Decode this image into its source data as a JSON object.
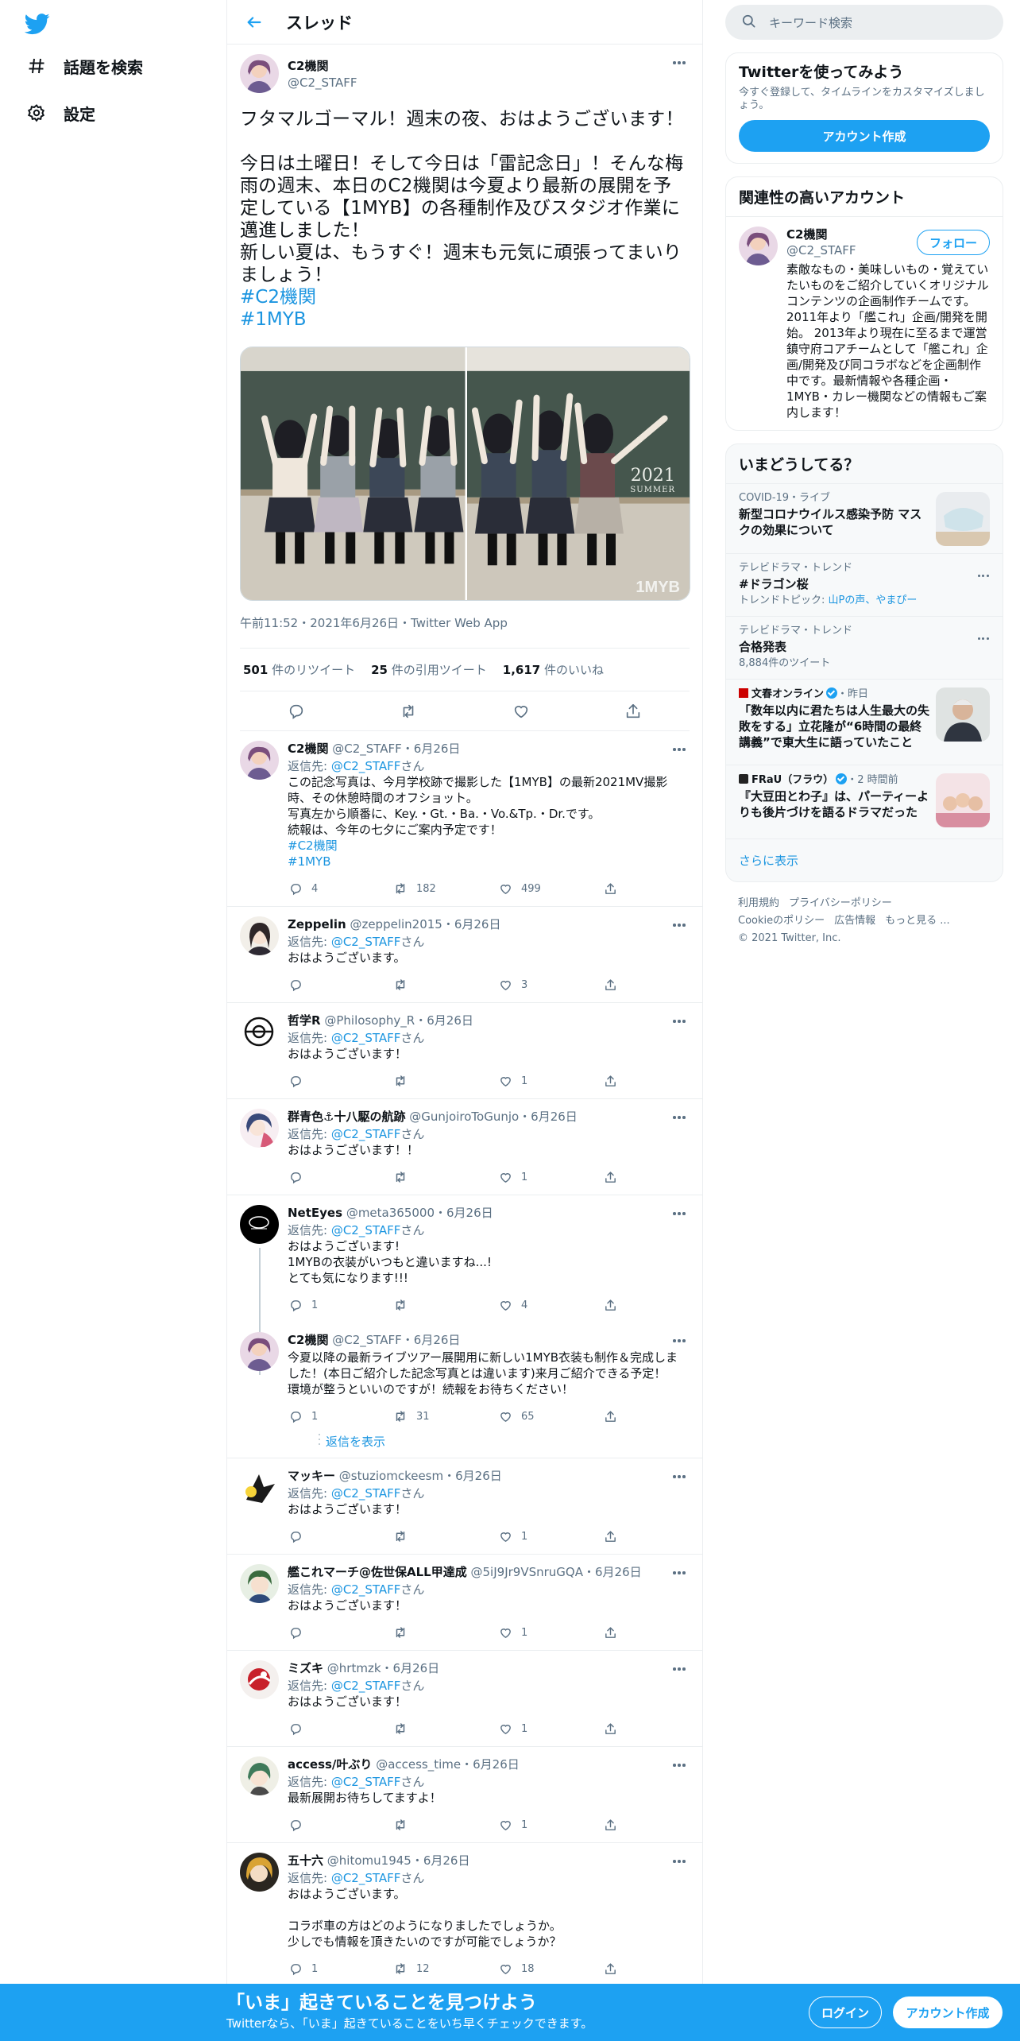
{
  "nav": {
    "items": [
      {
        "label": "話題を検索",
        "icon": "hashtag-icon"
      },
      {
        "label": "設定",
        "icon": "gear-icon"
      }
    ]
  },
  "header": {
    "title": "スレッド"
  },
  "main_tweet": {
    "name": "C2機関",
    "handle": "@C2_STAFF",
    "text_1": "フタマルゴーマル！週末の夜、おはようございます！",
    "text_2": "今日は土曜日！そして今日は「雷記念日」！そんな梅雨の週末、本日のC2機関は今夏より最新の展開を予定している【1MYB】の各種制作及びスタジオ作業に邁進しました！",
    "text_3": "新しい夏は、もうすぐ！週末も元気に頑張ってまいりましょう！",
    "hashtags": [
      "#C2機関",
      "#1MYB"
    ],
    "media_overlay_1": "2021",
    "media_overlay_2": "SUMMER",
    "media_overlay_3": "1MYB",
    "meta": "午前11:52・2021年6月26日・Twitter Web App",
    "retweets": "501",
    "retweets_label": "件のリツイート",
    "quotes": "25",
    "quotes_label": "件の引用ツイート",
    "likes": "1,617",
    "likes_label": "件のいいね"
  },
  "replies": [
    {
      "name": "C2機関",
      "handle": "@C2_STAFF",
      "date": "・6月26日",
      "reply_prefix": "返信先: ",
      "reply_to": "@C2_STAFF",
      "reply_suffix": "さん",
      "lines": [
        "この記念写真は、今月学校跡で撮影した【1MYB】の最新2021MV撮影時、その休憩時間のオフショット。",
        "写真左から順番に、Key.・Gt.・Ba.・Vo.&Tp.・Dr.です。",
        "続報は、今年の七夕にご案内予定です！"
      ],
      "tags": [
        "#C2機関",
        "#1MYB"
      ],
      "reply_count": "4",
      "rt_count": "182",
      "like_count": "499"
    },
    {
      "name": "Zeppelin",
      "handle": "@zeppelin2015",
      "date": "・6月26日",
      "reply_prefix": "返信先: ",
      "reply_to": "@C2_STAFF",
      "reply_suffix": "さん",
      "lines": [
        "おはようございます。"
      ],
      "reply_count": "",
      "rt_count": "",
      "like_count": "3"
    },
    {
      "name": "哲学R",
      "handle": "@Philosophy_R",
      "date": "・6月26日",
      "reply_prefix": "返信先: ",
      "reply_to": "@C2_STAFF",
      "reply_suffix": "さん",
      "lines": [
        "おはようございます！"
      ],
      "reply_count": "",
      "rt_count": "",
      "like_count": "1"
    },
    {
      "name": "群青色⚓十八駆の航跡",
      "handle": "@GunjoiroToGunjo",
      "date": "・6月26日",
      "reply_prefix": "返信先: ",
      "reply_to": "@C2_STAFF",
      "reply_suffix": "さん",
      "lines": [
        "おはようございます！！"
      ],
      "reply_count": "",
      "rt_count": "",
      "like_count": "1"
    },
    {
      "name": "NetEyes",
      "handle": "@meta365000",
      "date": "・6月26日",
      "reply_prefix": "返信先: ",
      "reply_to": "@C2_STAFF",
      "reply_suffix": "さん",
      "lines": [
        "おはようございます!",
        "1MYBの衣装がいつもと違いますね...!",
        "とても気になります!!!"
      ],
      "reply_count": "1",
      "rt_count": "",
      "like_count": "4"
    },
    {
      "name": "C2機関",
      "handle": "@C2_STAFF",
      "date": "・6月26日",
      "lines": [
        "今夏以降の最新ライブツアー展開用に新しい1MYB衣装も制作＆完成しました！(本日ご紹介した記念写真とは違います)来月ご紹介できる予定！",
        "環境が整うといいのですが！続報をお待ちください！"
      ],
      "reply_count": "1",
      "rt_count": "31",
      "like_count": "65",
      "show_replies": "返信を表示"
    },
    {
      "name": "マッキー",
      "handle": "@stuziomckeesm",
      "date": "・6月26日",
      "reply_prefix": "返信先: ",
      "reply_to": "@C2_STAFF",
      "reply_suffix": "さん",
      "lines": [
        "おはようございます！"
      ],
      "reply_count": "",
      "rt_count": "",
      "like_count": "1"
    },
    {
      "name": "艦これマーチ@佐世保ALL甲達成",
      "handle": "@5iJ9Jr9VSnruGQA",
      "date": "・6月26日",
      "reply_prefix": "返信先: ",
      "reply_to": "@C2_STAFF",
      "reply_suffix": "さん",
      "lines": [
        "おはようございます！"
      ],
      "reply_count": "",
      "rt_count": "",
      "like_count": "1"
    },
    {
      "name": "ミズキ",
      "handle": "@hrtmzk",
      "date": "・6月26日",
      "reply_prefix": "返信先: ",
      "reply_to": "@C2_STAFF",
      "reply_suffix": "さん",
      "lines": [
        "おはようございます！"
      ],
      "reply_count": "",
      "rt_count": "",
      "like_count": "1"
    },
    {
      "name": "access/叶ぶり",
      "handle": "@access_time",
      "date": "・6月26日",
      "reply_prefix": "返信先: ",
      "reply_to": "@C2_STAFF",
      "reply_suffix": "さん",
      "lines": [
        "最新展開お待ちしてますよ！"
      ],
      "reply_count": "",
      "rt_count": "",
      "like_count": "1"
    },
    {
      "name": "五十六",
      "handle": "@hitomu1945",
      "date": "・6月26日",
      "reply_prefix": "返信先: ",
      "reply_to": "@C2_STAFF",
      "reply_suffix": "さん",
      "lines": [
        "おはようございます。",
        "",
        "コラボ車の方はどのようになりましたでしょうか。",
        "少しでも情報を頂きたいのですが可能でしょうか？"
      ],
      "reply_count": "1",
      "rt_count": "12",
      "like_count": "18"
    }
  ],
  "sidebar": {
    "search_placeholder": "キーワード検索",
    "join_title": "Twitterを使ってみよう",
    "join_desc": "今すぐ登録して、タイムラインをカスタマイズしましょう。",
    "join_button": "アカウント作成",
    "related_title": "関連性の高いアカウント",
    "related": {
      "name": "C2機関",
      "handle": "@C2_STAFF",
      "follow": "フォロー",
      "bio": "素敵なもの・美味しいもの・覚えていたいものをご紹介していくオリジナルコンテンツの企画制作チームです。2011年より「艦これ」企画/開発を開始。 2013年より現在に至るまで運営鎮守府コアチームとして「艦これ」企画/開発及び同コラボなどを企画制作中です。最新情報や各種企画・1MYB・カレー機関などの情報もご案内します！"
    },
    "trends_title": "いまどうしてる？",
    "trends": [
      {
        "ctx": "COVID-19・ライブ",
        "title": "新型コロナウイルス感染予防 マスクの効果について"
      },
      {
        "ctx": "テレビドラマ・トレンド",
        "title": "#ドラゴン桜",
        "sub_prefix": "トレンドトピック: ",
        "sub_link": "山Pの声、やまぴー"
      },
      {
        "ctx": "テレビドラマ・トレンド",
        "title": "合格発表",
        "sub": "8,884件のツイート"
      },
      {
        "source": "文春オンライン",
        "time": "・昨日",
        "title": "「数年以内に君たちは人生最大の失敗をする」立花隆が“6時間の最終講義”で東大生に語っていたこと"
      },
      {
        "source": "FRaU（フラウ）",
        "time": "・2 時間前",
        "title": "『大豆田とわ子』は、パーティーよりも後片づけを語るドラマだった"
      }
    ],
    "show_more": "さらに表示",
    "footer": [
      "利用規約",
      "プライバシーポリシー",
      "Cookieのポリシー",
      "広告情報",
      "もっと見る ...",
      "© 2021 Twitter, Inc."
    ]
  },
  "bottom_bar": {
    "headline": "「いま」起きていることを見つけよう",
    "sub": "Twitterなら、「いま」起きていることをいち早くチェックできます。",
    "login": "ログイン",
    "signup": "アカウント作成"
  },
  "colors": {
    "accent": "#1da1f2",
    "link": "#1b95e0",
    "muted": "#5b7083",
    "border": "#ebeef0"
  }
}
